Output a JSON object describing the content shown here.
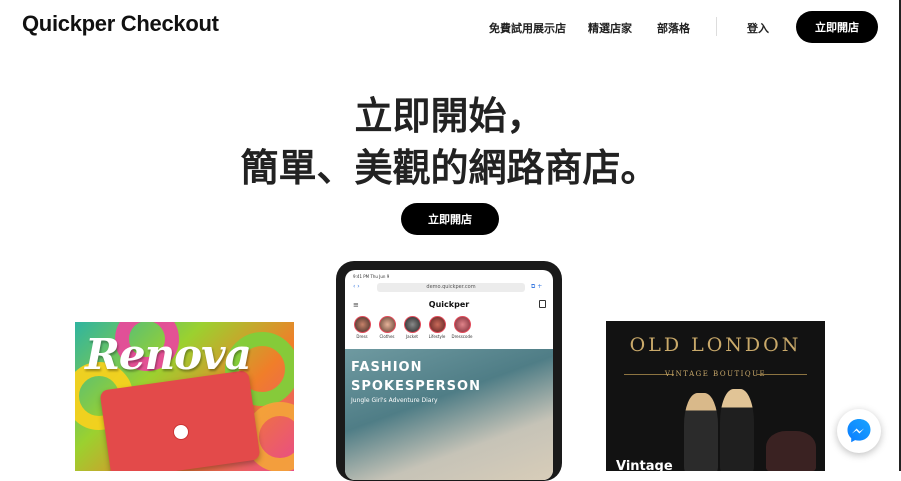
{
  "header": {
    "logo": "Quickper Checkout",
    "nav": [
      "免費試用展示店",
      "精選店家",
      "部落格"
    ],
    "login": "登入",
    "cta": "立即開店"
  },
  "hero": {
    "line1": "立即開始，",
    "line2": "簡單、美觀的網路商店。",
    "cta": "立即開店"
  },
  "showcase": {
    "left_card": {
      "brand": "Renova"
    },
    "tablet": {
      "status": "9:41 PM Thu Jun 9",
      "url": "demo.quickper.com",
      "site_title": "Quickper",
      "stories": [
        "Dress",
        "Clothes",
        "Jacket",
        "Lifestyle",
        "Dresscode"
      ],
      "banner_title_1": "FASHION",
      "banner_title_2": "SPOKESPERSON",
      "banner_subtitle": "Jungle Girl's Adventure Diary"
    },
    "right_card": {
      "title": "OLD LONDON",
      "subtitle": "VINTAGE BOUTIQUE",
      "caption": "Vintage"
    }
  },
  "icons": {
    "messenger": "messenger-icon",
    "menu": "hamburger-icon",
    "bag": "shopping-bag-icon"
  }
}
